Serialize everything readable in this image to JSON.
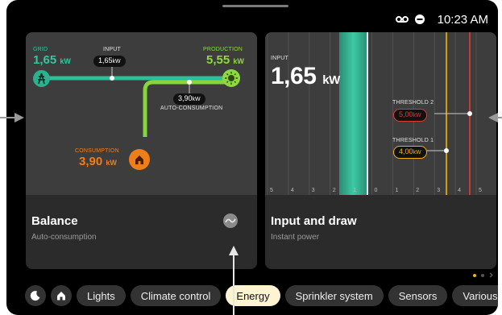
{
  "status": {
    "time": "10:23 AM",
    "voicemail_icon": "voicemail-icon",
    "dnd_icon": "do-not-disturb-icon"
  },
  "balance_card": {
    "title": "Balance",
    "subtitle": "Auto-consumption",
    "grid": {
      "label": "GRID",
      "value": "1,65",
      "unit": "kW"
    },
    "input": {
      "label": "INPUT",
      "value": "1,65",
      "unit": "kW"
    },
    "production": {
      "label": "PRODUCTION",
      "value": "5,55",
      "unit": "kW"
    },
    "auto": {
      "label": "AUTO-CONSUMPTION",
      "value": "3,90",
      "unit": "kW"
    },
    "consumption": {
      "label": "CONSUMPTION",
      "value": "3,90",
      "unit": "kW"
    },
    "colors": {
      "grid": "#28b28f",
      "production": "#8ed93f",
      "consumption": "#ee7e1a"
    }
  },
  "input_card": {
    "title": "Input and draw",
    "subtitle": "Instant power",
    "input_label": "INPUT",
    "input_value": "1,65",
    "input_unit": "kW",
    "threshold2": {
      "label": "THRESHOLD 2",
      "value": "5,00",
      "unit": "kW",
      "color": "#e53935"
    },
    "threshold1": {
      "label": "THRESHOLD 1",
      "value": "4,00",
      "unit": "kW",
      "color": "#f4b400"
    },
    "scale": [
      "5",
      "4",
      "3",
      "2",
      "1",
      "0",
      "1",
      "2",
      "3",
      "4",
      "5"
    ]
  },
  "categories": [
    {
      "name": "night-mode",
      "icon": "moon-icon"
    },
    {
      "name": "home",
      "icon": "home-icon"
    },
    {
      "name": "lights",
      "label": "Lights"
    },
    {
      "name": "climate",
      "label": "Climate control"
    },
    {
      "name": "energy",
      "label": "Energy",
      "active": true
    },
    {
      "name": "sprinkler",
      "label": "Sprinkler system"
    },
    {
      "name": "sensors",
      "label": "Sensors"
    },
    {
      "name": "various",
      "label": "Various"
    }
  ],
  "pagination": {
    "pages": 2,
    "current": 1
  }
}
